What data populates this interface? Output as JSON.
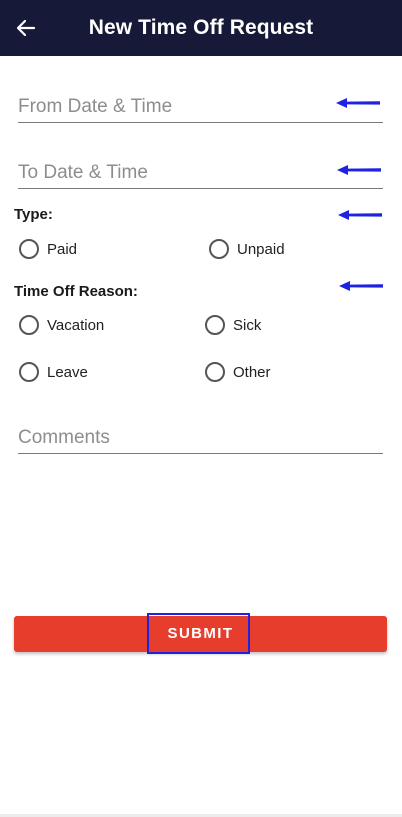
{
  "appbar": {
    "title": "New Time Off Request",
    "back_icon": "arrow-left-icon",
    "background": "#161a38"
  },
  "form": {
    "from_date": {
      "placeholder": "From Date & Time",
      "value": ""
    },
    "to_date": {
      "placeholder": "To Date & Time",
      "value": ""
    },
    "type": {
      "label": "Type:",
      "options": [
        {
          "label": "Paid",
          "selected": false
        },
        {
          "label": "Unpaid",
          "selected": false
        }
      ]
    },
    "reason": {
      "label": "Time Off Reason:",
      "options": [
        {
          "label": "Vacation",
          "selected": false
        },
        {
          "label": "Sick",
          "selected": false
        },
        {
          "label": "Leave",
          "selected": false
        },
        {
          "label": "Other",
          "selected": false
        }
      ]
    },
    "comments": {
      "placeholder": "Comments",
      "value": ""
    },
    "submit_label": "SUBMIT"
  },
  "annotations": {
    "arrow_icon": "arrow-left-annotation-icon",
    "arrow_color": "#1f22e0",
    "highlight_color": "#1f22e0"
  },
  "colors": {
    "accent": "#e63d2d",
    "appbar": "#161a38",
    "annotation": "#1f22e0"
  }
}
